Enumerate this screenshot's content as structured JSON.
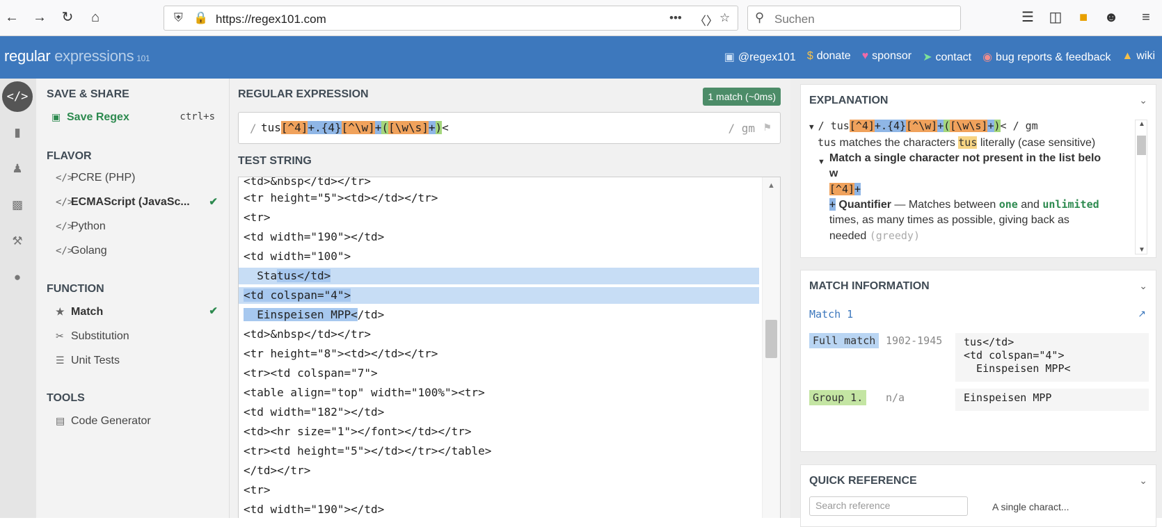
{
  "browser": {
    "url": "https://regex101.com",
    "search_placeholder": "Suchen"
  },
  "header": {
    "logo_regular": "regular",
    "logo_expressions": " expressions",
    "logo_sub": "101",
    "links": [
      "@regex101",
      "donate",
      "sponsor",
      "contact",
      "bug reports & feedback",
      "wiki"
    ],
    "link_icons": [
      "twitter-icon",
      "dollar-icon",
      "heart-icon",
      "paper-plane-icon",
      "bug-icon",
      "bank-icon"
    ]
  },
  "sidebar": {
    "save_share": "SAVE & SHARE",
    "save_regex": "Save Regex",
    "save_shortcut": "ctrl+s",
    "flavor": "FLAVOR",
    "flavors": [
      "PCRE (PHP)",
      "ECMAScript (JavaSc...",
      "Python",
      "Golang"
    ],
    "function": "FUNCTION",
    "functions": [
      "Match",
      "Substitution",
      "Unit Tests"
    ],
    "tools": "TOOLS",
    "tool_items": [
      "Code Generator"
    ]
  },
  "regex": {
    "heading": "REGULAR EXPRESSION",
    "match_badge": "1 match (~0ms)",
    "delimiter": "/",
    "tokens": [
      "tus",
      "[^4]",
      "+",
      ".",
      "{4}",
      "[^\\w]",
      "+",
      "(",
      "[\\w\\s]",
      "+",
      ")",
      "<"
    ],
    "flags": "/ gm"
  },
  "test": {
    "heading": "TEST STRING",
    "lines": [
      "<td>&nbsp</td></tr>",
      "<tr height=\"5\"><td></td></tr>",
      "<tr>",
      "<td width=\"190\"></td>",
      "<td width=\"100\">",
      "  Sta",
      "tus</td>",
      "<td colspan=\"4\">",
      "  Einspeisen MPP<",
      "/td>",
      "<td>&nbsp</td></tr>",
      "<tr height=\"8\"><td></td></tr>",
      "<tr><td colspan=\"7\">",
      "<table align=\"top\" width=\"100%\"><tr>",
      "<td width=\"182\"></td>",
      "<td><hr size=\"1\"></font></td></tr>",
      "<tr><td height=\"5\"></td></tr></table>",
      "</td></tr>",
      "<tr>",
      "<td width=\"190\"></td>"
    ]
  },
  "explanation": {
    "heading": "EXPLANATION",
    "pattern_head": "/ tus",
    "pattern_tail": "< / gm",
    "line1_a": "tus",
    "line1_b": " matches the characters ",
    "line1_c": "tus",
    "line1_d": " literally (case sensitive)",
    "item_title": "Match a single character not present in the list below",
    "item_token": "[^4]",
    "item_plus": "+",
    "quant_title": "Quantifier",
    "quant_desc1": " — Matches between ",
    "quant_one": "one",
    "quant_and": " and",
    "quant_unlimited": "unlimited",
    "quant_desc2": " times, as many times as possible, giving back as needed ",
    "quant_greedy": "(greedy)"
  },
  "match_info": {
    "heading": "MATCH INFORMATION",
    "match_title": "Match 1",
    "full_label": "Full match",
    "full_range": "1902-1945",
    "full_value": "tus</td>\n<td colspan=\"4\">\n  Einspeisen MPP<",
    "group_label": "Group 1.",
    "group_range": "n/a",
    "group_value": "Einspeisen MPP"
  },
  "quick_ref": {
    "heading": "QUICK REFERENCE",
    "search_placeholder": "Search reference",
    "text": "A single charact..."
  },
  "colors": {
    "header_bg": "#3d78bd",
    "match_badge": "#4c8c68",
    "match_highlight": "#a7c8ef",
    "class_token": "#f0a25c",
    "group_token": "#a4d67c"
  }
}
